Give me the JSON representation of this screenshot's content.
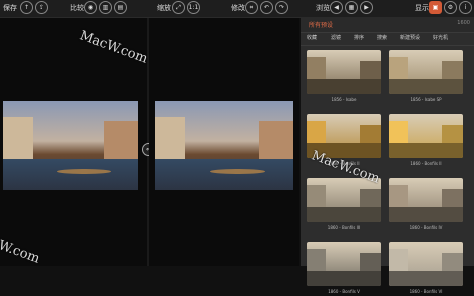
{
  "toolbar": {
    "save_label": "保存",
    "compare_label": "比较",
    "zoom_label": "缩放",
    "zoom_ratio": "1:1",
    "edit_label": "修改",
    "browse_label": "浏览",
    "show_label": "显示"
  },
  "panel": {
    "title": "所有预设",
    "count": "1600",
    "tabs": [
      "收藏",
      "滤镜",
      "排序",
      "搜索",
      "新建预设",
      "好光机"
    ],
    "presets": [
      "1856 - Isabe",
      "1856 - Isabe SP",
      "1860 - Bonfils II",
      "1860 - Bonfils II",
      "1860 - Bonfils III",
      "1860 - Bonfils IV",
      "1860 - Bonfils V",
      "1860 - Bonfils VI"
    ],
    "preset_tones": [
      "#7a6a52",
      "#9a8868",
      "#b58a3a",
      "#c9a24a",
      "#7d7464",
      "#8b7e6c",
      "#6f6a60",
      "#a29a8c"
    ]
  },
  "watermark": "MacW.com"
}
